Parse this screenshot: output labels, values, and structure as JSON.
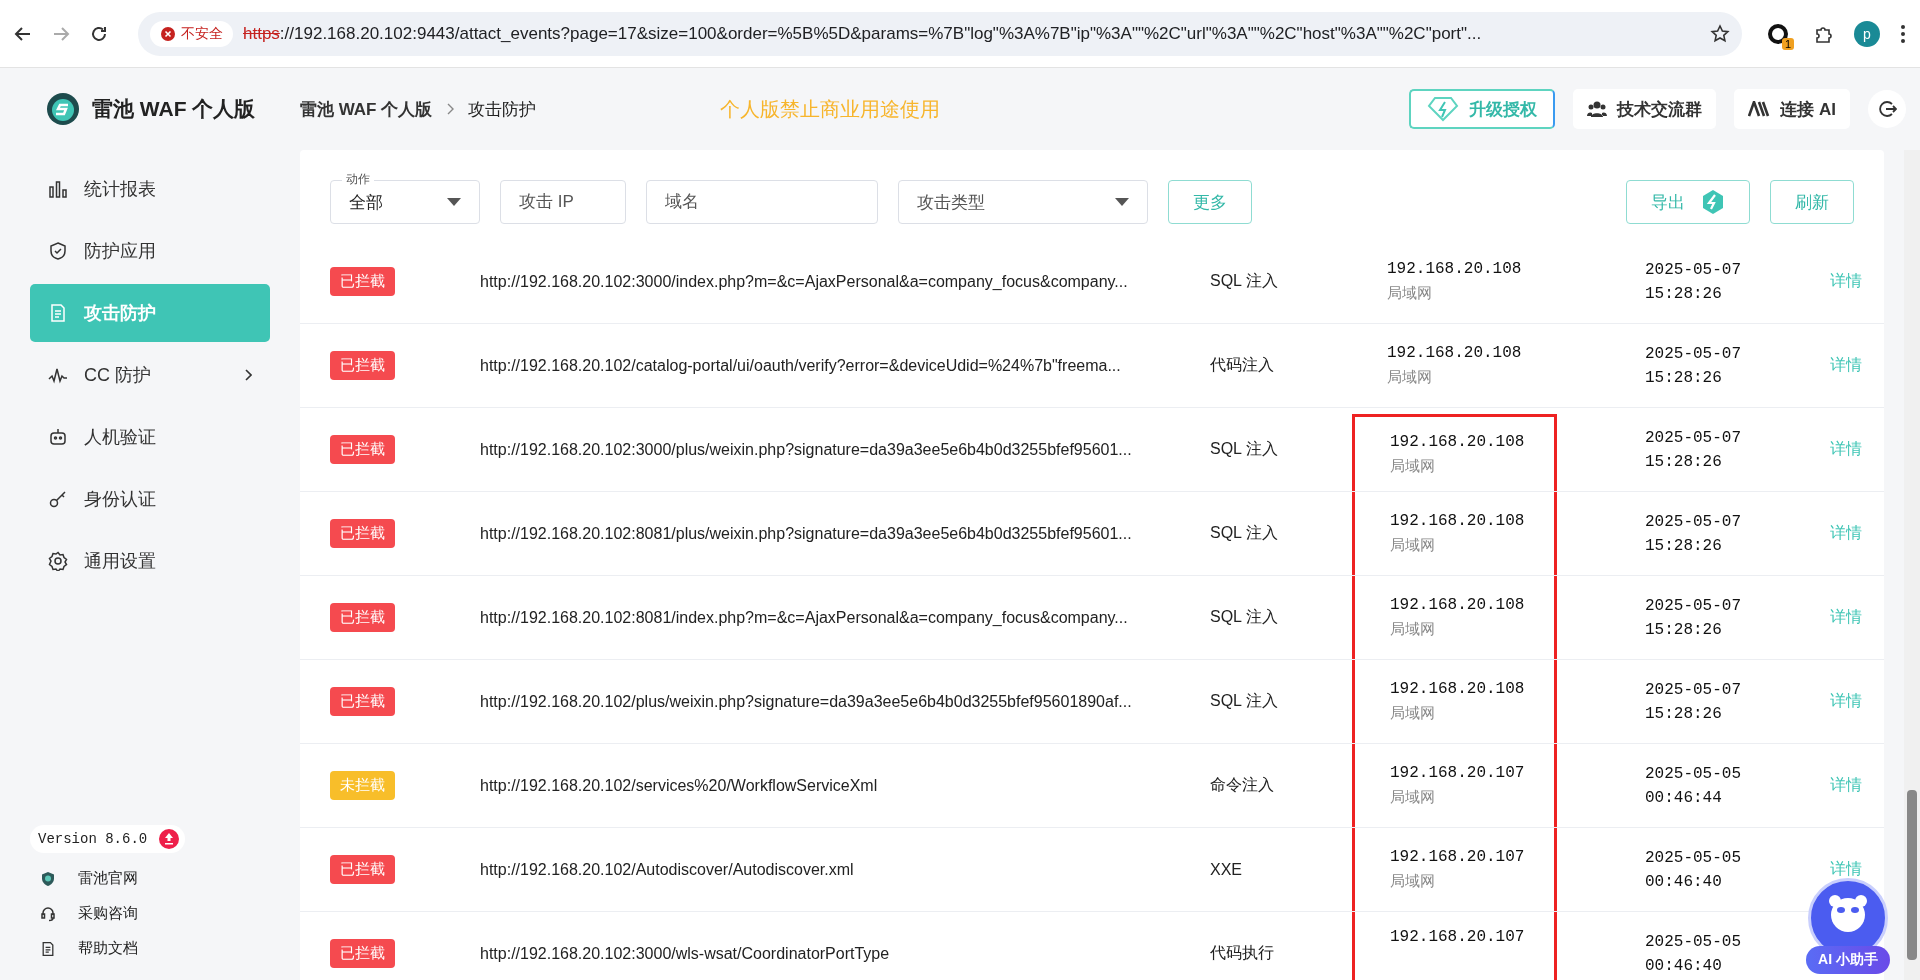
{
  "browser": {
    "security_warning": "不安全",
    "url_scheme": "https",
    "url_rest": "://192.168.20.102:9443/attact_events?page=17&size=100&order=%5B%5D&params=%7B\"log\"%3A%7B\"ip\"%3A\"\"%2C\"url\"%3A\"\"%2C\"host\"%3A\"\"%2C\"port\"...",
    "extension_badge": "1",
    "profile": "p"
  },
  "header": {
    "logo": "雷池 WAF 个人版",
    "breadcrumb": [
      "雷池 WAF 个人版",
      "攻击防护"
    ],
    "notice": "个人版禁止商业用途使用",
    "buttons": [
      {
        "label": "升级授权",
        "kind": "upgrade"
      },
      {
        "label": "技术交流群",
        "kind": "group"
      },
      {
        "label": "连接 AI",
        "kind": "ai"
      }
    ]
  },
  "sidebar": {
    "items": [
      {
        "label": "统计报表",
        "kind": "chart",
        "selected": false
      },
      {
        "label": "防护应用",
        "kind": "shield",
        "selected": false
      },
      {
        "label": "攻击防护",
        "kind": "doc",
        "selected": true
      },
      {
        "label": "CC 防护",
        "kind": "wave",
        "selected": false,
        "expandable": true
      },
      {
        "label": "人机验证",
        "kind": "robot",
        "selected": false
      },
      {
        "label": "身份认证",
        "kind": "key",
        "selected": false
      },
      {
        "label": "通用设置",
        "kind": "gear",
        "selected": false
      }
    ],
    "version": "Version 8.6.0",
    "links": [
      {
        "label": "雷池官网",
        "kind": "shield"
      },
      {
        "label": "采购咨询",
        "kind": "headset"
      },
      {
        "label": "帮助文档",
        "kind": "doc"
      }
    ]
  },
  "filters": {
    "action": {
      "label": "动作",
      "value": "全部"
    },
    "ip": {
      "placeholder": "攻击 IP"
    },
    "domain": {
      "placeholder": "域名"
    },
    "attack_type": {
      "placeholder": "攻击类型"
    },
    "more": "更多",
    "export": "导出",
    "refresh": "刷新"
  },
  "rows": [
    {
      "status": "已拦截",
      "blocked": true,
      "url": "http://192.168.20.102:3000/index.php?m=&c=AjaxPersonal&a=company_focus&company...",
      "type": "SQL 注入",
      "ip": "192.168.20.108",
      "network": "局域网",
      "date": "2025-05-07",
      "time": "15:28:26",
      "action": "详情",
      "highlighted": false
    },
    {
      "status": "已拦截",
      "blocked": true,
      "url": "http://192.168.20.102/catalog-portal/ui/oauth/verify?error=&deviceUdid=%24%7b\"freema...",
      "type": "代码注入",
      "ip": "192.168.20.108",
      "network": "局域网",
      "date": "2025-05-07",
      "time": "15:28:26",
      "action": "详情",
      "highlighted": false
    },
    {
      "status": "已拦截",
      "blocked": true,
      "url": "http://192.168.20.102:3000/plus/weixin.php?signature=da39a3ee5e6b4b0d3255bfef95601...",
      "type": "SQL 注入",
      "ip": "192.168.20.108",
      "network": "局域网",
      "date": "2025-05-07",
      "time": "15:28:26",
      "action": "详情",
      "highlighted": true
    },
    {
      "status": "已拦截",
      "blocked": true,
      "url": "http://192.168.20.102:8081/plus/weixin.php?signature=da39a3ee5e6b4b0d3255bfef95601...",
      "type": "SQL 注入",
      "ip": "192.168.20.108",
      "network": "局域网",
      "date": "2025-05-07",
      "time": "15:28:26",
      "action": "详情",
      "highlighted": true
    },
    {
      "status": "已拦截",
      "blocked": true,
      "url": "http://192.168.20.102:8081/index.php?m=&c=AjaxPersonal&a=company_focus&company...",
      "type": "SQL 注入",
      "ip": "192.168.20.108",
      "network": "局域网",
      "date": "2025-05-07",
      "time": "15:28:26",
      "action": "详情",
      "highlighted": true
    },
    {
      "status": "已拦截",
      "blocked": true,
      "url": "http://192.168.20.102/plus/weixin.php?signature=da39a3ee5e6b4b0d3255bfef95601890af...",
      "type": "SQL 注入",
      "ip": "192.168.20.108",
      "network": "局域网",
      "date": "2025-05-07",
      "time": "15:28:26",
      "action": "详情",
      "highlighted": true
    },
    {
      "status": "未拦截",
      "blocked": false,
      "url": "http://192.168.20.102/services%20/WorkflowServiceXml",
      "type": "命令注入",
      "ip": "192.168.20.107",
      "network": "局域网",
      "date": "2025-05-05",
      "time": "00:46:44",
      "action": "详情",
      "highlighted": true
    },
    {
      "status": "已拦截",
      "blocked": true,
      "url": "http://192.168.20.102/Autodiscover/Autodiscover.xml",
      "type": "XXE",
      "ip": "192.168.20.107",
      "network": "局域网",
      "date": "2025-05-05",
      "time": "00:46:40",
      "action": "详情",
      "highlighted": true
    },
    {
      "status": "已拦截",
      "blocked": true,
      "url": "http://192.168.20.102:3000/wls-wsat/CoordinatorPortType",
      "type": "代码执行",
      "ip": "192.168.20.107",
      "date": "2025-05-05",
      "time": "00:46:40",
      "highlighted": true
    }
  ],
  "assistant": {
    "label": "AI 小助手"
  }
}
